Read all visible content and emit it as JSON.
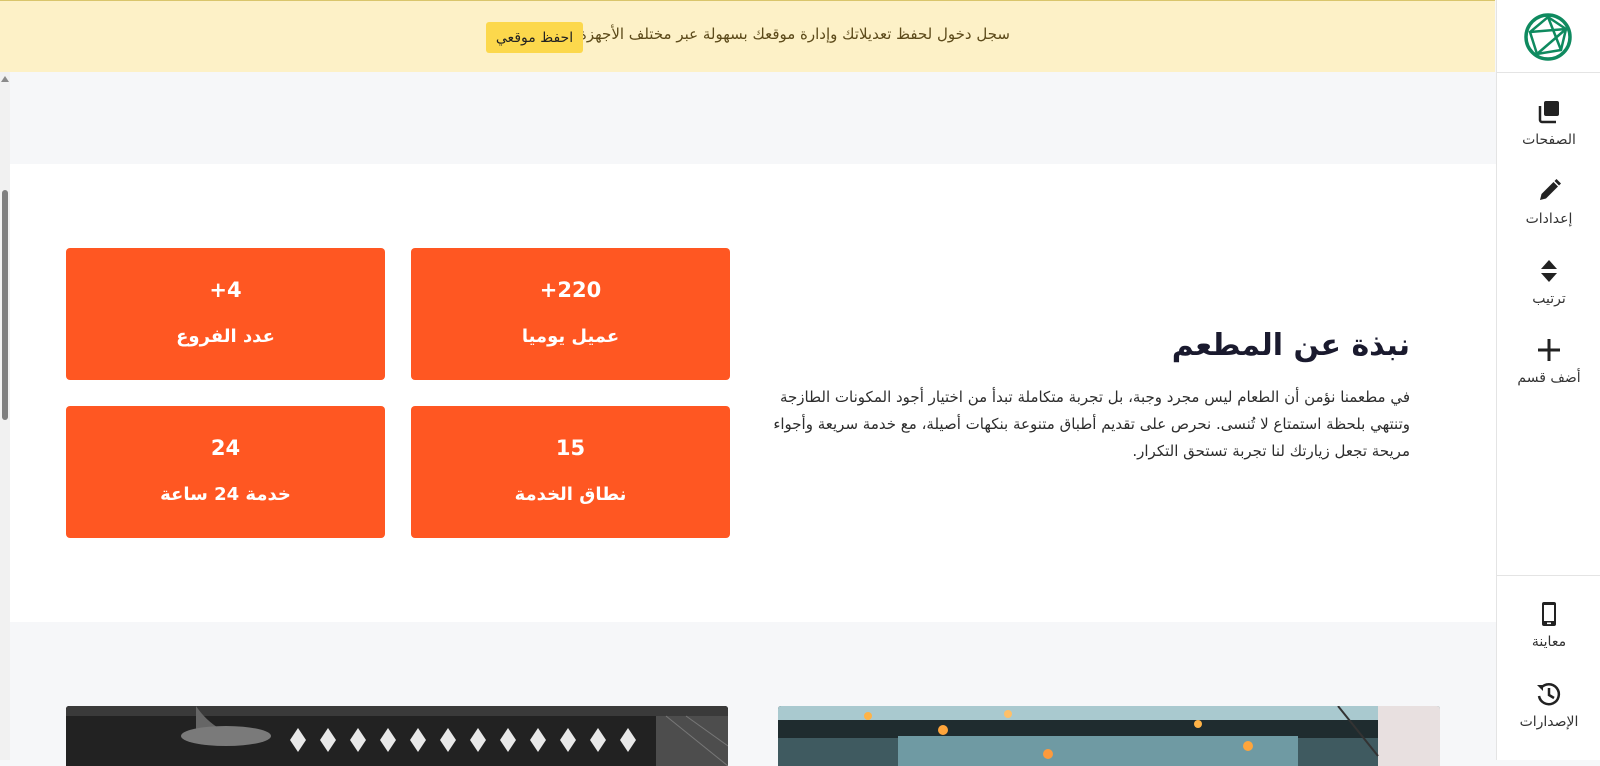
{
  "banner": {
    "message": "سجل دخول لحفظ تعديلاتك وإدارة موقعك بسهولة عبر مختلف الأجهزة",
    "button_label": "احفظ موقعي"
  },
  "toolbar": {
    "items": [
      {
        "label": "الصفحات",
        "icon": "pages-icon"
      },
      {
        "label": "إعدادات",
        "icon": "pencil-icon"
      },
      {
        "label": "ترتيب",
        "icon": "sort-icon"
      },
      {
        "label": "أضف قسم",
        "icon": "plus-icon"
      }
    ],
    "bottom_items": [
      {
        "label": "معاينة",
        "icon": "mobile-preview-icon"
      },
      {
        "label": "الإصدارات",
        "icon": "history-icon"
      }
    ]
  },
  "about": {
    "title": "نبذة عن المطعم",
    "body": "في مطعمنا نؤمن أن الطعام ليس مجرد وجبة، بل تجربة متكاملة تبدأ من اختيار أجود المكونات الطازجة وتنتهي بلحظة استمتاع لا تُنسى. نحرص على تقديم أطباق متنوعة بنكهات أصيلة، مع خدمة سريعة وأجواء مريحة تجعل زيارتك لنا تجربة تستحق التكرار."
  },
  "stats": [
    {
      "number": "+220",
      "caption": "عميل يوميا"
    },
    {
      "number": "+4",
      "caption": "عدد الفروع"
    },
    {
      "number": "15",
      "caption": "نطاق الخدمة"
    },
    {
      "number": "24",
      "caption": "خدمة 24 ساعة"
    }
  ],
  "colors": {
    "accent": "#ff5722",
    "banner_bg": "#fdf1c7",
    "banner_button": "#fcd84c",
    "logo": "#0f8a5f"
  }
}
